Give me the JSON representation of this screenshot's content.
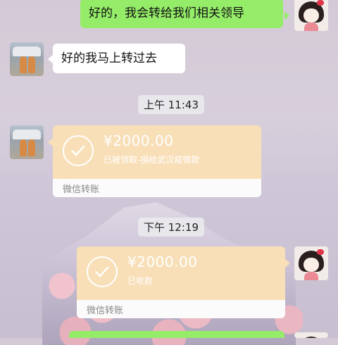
{
  "messages": {
    "m1_text": "好的，我会转给我们相关领导",
    "m2_text": "好的我马上转过去"
  },
  "timestamps": {
    "t1": "上午 11:43",
    "t2": "下午 12:19"
  },
  "transfer_received_by_them": {
    "amount": "¥2000.00",
    "status": "已被领取-捐给武汉疫情款",
    "label": "微信转账"
  },
  "transfer_received_by_me": {
    "amount": "¥2000.00",
    "status": "已收款",
    "label": "微信转账"
  },
  "colors": {
    "green_bubble": "#95ec69",
    "transfer_card": "#f8dfb8"
  }
}
